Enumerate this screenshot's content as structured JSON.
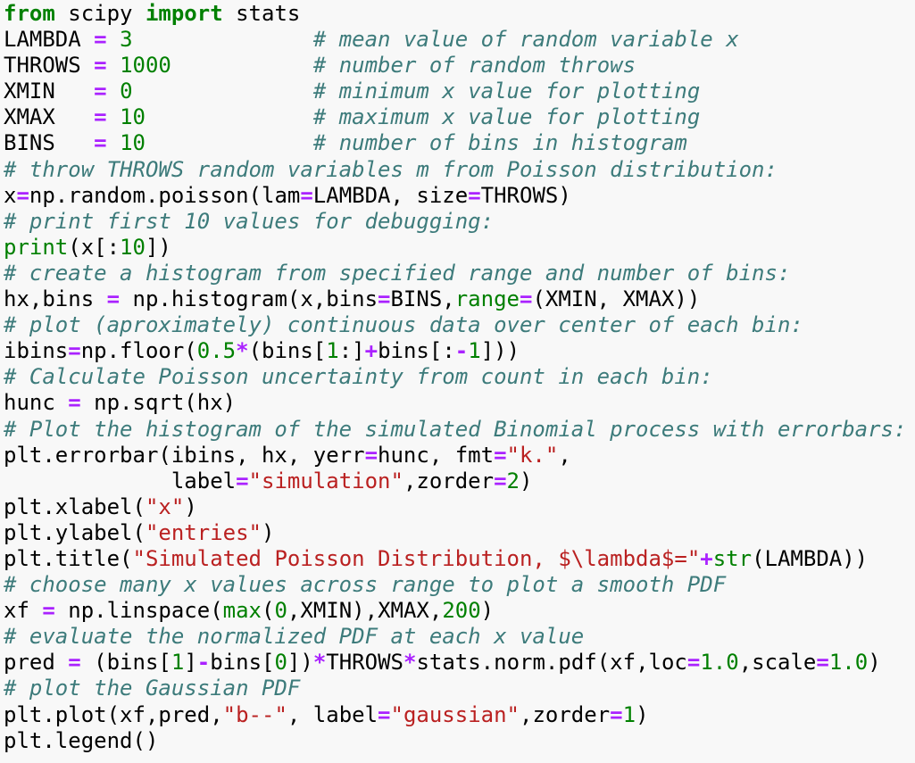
{
  "code_view": {
    "language": "python",
    "lines": [
      [
        {
          "t": "kw",
          "s": "from"
        },
        {
          "t": "pl",
          "s": " scipy "
        },
        {
          "t": "kw",
          "s": "import"
        },
        {
          "t": "pl",
          "s": " stats"
        }
      ],
      [
        {
          "t": "pl",
          "s": "LAMBDA "
        },
        {
          "t": "op",
          "s": "="
        },
        {
          "t": "pl",
          "s": " "
        },
        {
          "t": "num",
          "s": "3"
        },
        {
          "t": "pl",
          "s": "              "
        },
        {
          "t": "cm",
          "s": "# mean value of random variable x"
        }
      ],
      [
        {
          "t": "pl",
          "s": "THROWS "
        },
        {
          "t": "op",
          "s": "="
        },
        {
          "t": "pl",
          "s": " "
        },
        {
          "t": "num",
          "s": "1000"
        },
        {
          "t": "pl",
          "s": "           "
        },
        {
          "t": "cm",
          "s": "# number of random throws"
        }
      ],
      [
        {
          "t": "pl",
          "s": "XMIN   "
        },
        {
          "t": "op",
          "s": "="
        },
        {
          "t": "pl",
          "s": " "
        },
        {
          "t": "num",
          "s": "0"
        },
        {
          "t": "pl",
          "s": "              "
        },
        {
          "t": "cm",
          "s": "# minimum x value for plotting"
        }
      ],
      [
        {
          "t": "pl",
          "s": "XMAX   "
        },
        {
          "t": "op",
          "s": "="
        },
        {
          "t": "pl",
          "s": " "
        },
        {
          "t": "num",
          "s": "10"
        },
        {
          "t": "pl",
          "s": "             "
        },
        {
          "t": "cm",
          "s": "# maximum x value for plotting"
        }
      ],
      [
        {
          "t": "pl",
          "s": "BINS   "
        },
        {
          "t": "op",
          "s": "="
        },
        {
          "t": "pl",
          "s": " "
        },
        {
          "t": "num",
          "s": "10"
        },
        {
          "t": "pl",
          "s": "             "
        },
        {
          "t": "cm",
          "s": "# number of bins in histogram"
        }
      ],
      [
        {
          "t": "cm",
          "s": "# throw THROWS random variables m from Poisson distribution:"
        }
      ],
      [
        {
          "t": "pl",
          "s": "x"
        },
        {
          "t": "op",
          "s": "="
        },
        {
          "t": "pl",
          "s": "np.random.poisson(lam"
        },
        {
          "t": "op",
          "s": "="
        },
        {
          "t": "pl",
          "s": "LAMBDA, size"
        },
        {
          "t": "op",
          "s": "="
        },
        {
          "t": "pl",
          "s": "THROWS)"
        }
      ],
      [
        {
          "t": "cm",
          "s": "# print first 10 values for debugging:"
        }
      ],
      [
        {
          "t": "bi",
          "s": "print"
        },
        {
          "t": "pl",
          "s": "(x[:"
        },
        {
          "t": "num",
          "s": "10"
        },
        {
          "t": "pl",
          "s": "])"
        }
      ],
      [
        {
          "t": "cm",
          "s": "# create a histogram from specified range and number of bins:"
        }
      ],
      [
        {
          "t": "pl",
          "s": "hx,bins "
        },
        {
          "t": "op",
          "s": "="
        },
        {
          "t": "pl",
          "s": " np.histogram(x,bins"
        },
        {
          "t": "op",
          "s": "="
        },
        {
          "t": "pl",
          "s": "BINS,"
        },
        {
          "t": "bi",
          "s": "range"
        },
        {
          "t": "op",
          "s": "="
        },
        {
          "t": "pl",
          "s": "(XMIN, XMAX))"
        }
      ],
      [
        {
          "t": "cm",
          "s": "# plot (aproximately) continuous data over center of each bin:"
        }
      ],
      [
        {
          "t": "pl",
          "s": "ibins"
        },
        {
          "t": "op",
          "s": "="
        },
        {
          "t": "pl",
          "s": "np.floor("
        },
        {
          "t": "num",
          "s": "0.5"
        },
        {
          "t": "op",
          "s": "*"
        },
        {
          "t": "pl",
          "s": "(bins["
        },
        {
          "t": "num",
          "s": "1"
        },
        {
          "t": "pl",
          "s": ":]"
        },
        {
          "t": "op",
          "s": "+"
        },
        {
          "t": "pl",
          "s": "bins[:"
        },
        {
          "t": "op",
          "s": "-"
        },
        {
          "t": "num",
          "s": "1"
        },
        {
          "t": "pl",
          "s": "]))"
        }
      ],
      [
        {
          "t": "cm",
          "s": "# Calculate Poisson uncertainty from count in each bin:"
        }
      ],
      [
        {
          "t": "pl",
          "s": "hunc "
        },
        {
          "t": "op",
          "s": "="
        },
        {
          "t": "pl",
          "s": " np.sqrt(hx)"
        }
      ],
      [
        {
          "t": "cm",
          "s": "# Plot the histogram of the simulated Binomial process with errorbars:"
        }
      ],
      [
        {
          "t": "pl",
          "s": "plt.errorbar(ibins, hx, yerr"
        },
        {
          "t": "op",
          "s": "="
        },
        {
          "t": "pl",
          "s": "hunc, fmt"
        },
        {
          "t": "op",
          "s": "="
        },
        {
          "t": "str",
          "s": "\"k.\""
        },
        {
          "t": "pl",
          "s": ","
        }
      ],
      [
        {
          "t": "pl",
          "s": "             label"
        },
        {
          "t": "op",
          "s": "="
        },
        {
          "t": "str",
          "s": "\"simulation\""
        },
        {
          "t": "pl",
          "s": ",zorder"
        },
        {
          "t": "op",
          "s": "="
        },
        {
          "t": "num",
          "s": "2"
        },
        {
          "t": "pl",
          "s": ")"
        }
      ],
      [
        {
          "t": "pl",
          "s": "plt.xlabel("
        },
        {
          "t": "str",
          "s": "\"x\""
        },
        {
          "t": "pl",
          "s": ")"
        }
      ],
      [
        {
          "t": "pl",
          "s": "plt.ylabel("
        },
        {
          "t": "str",
          "s": "\"entries\""
        },
        {
          "t": "pl",
          "s": ")"
        }
      ],
      [
        {
          "t": "pl",
          "s": "plt.title("
        },
        {
          "t": "str",
          "s": "\"Simulated Poisson Distribution, $\\lambda$=\""
        },
        {
          "t": "op",
          "s": "+"
        },
        {
          "t": "bi",
          "s": "str"
        },
        {
          "t": "pl",
          "s": "(LAMBDA))"
        }
      ],
      [
        {
          "t": "cm",
          "s": "# choose many x values across range to plot a smooth PDF"
        }
      ],
      [
        {
          "t": "pl",
          "s": "xf "
        },
        {
          "t": "op",
          "s": "="
        },
        {
          "t": "pl",
          "s": " np.linspace("
        },
        {
          "t": "bi",
          "s": "max"
        },
        {
          "t": "pl",
          "s": "("
        },
        {
          "t": "num",
          "s": "0"
        },
        {
          "t": "pl",
          "s": ",XMIN),XMAX,"
        },
        {
          "t": "num",
          "s": "200"
        },
        {
          "t": "pl",
          "s": ")"
        }
      ],
      [
        {
          "t": "cm",
          "s": "# evaluate the normalized PDF at each x value"
        }
      ],
      [
        {
          "t": "pl",
          "s": "pred "
        },
        {
          "t": "op",
          "s": "="
        },
        {
          "t": "pl",
          "s": " (bins["
        },
        {
          "t": "num",
          "s": "1"
        },
        {
          "t": "pl",
          "s": "]"
        },
        {
          "t": "op",
          "s": "-"
        },
        {
          "t": "pl",
          "s": "bins["
        },
        {
          "t": "num",
          "s": "0"
        },
        {
          "t": "pl",
          "s": "])"
        },
        {
          "t": "op",
          "s": "*"
        },
        {
          "t": "pl",
          "s": "THROWS"
        },
        {
          "t": "op",
          "s": "*"
        },
        {
          "t": "pl",
          "s": "stats.norm.pdf(xf,loc"
        },
        {
          "t": "op",
          "s": "="
        },
        {
          "t": "num",
          "s": "1.0"
        },
        {
          "t": "pl",
          "s": ",scale"
        },
        {
          "t": "op",
          "s": "="
        },
        {
          "t": "num",
          "s": "1.0"
        },
        {
          "t": "pl",
          "s": ")"
        }
      ],
      [
        {
          "t": "cm",
          "s": "# plot the Gaussian PDF"
        }
      ],
      [
        {
          "t": "pl",
          "s": "plt.plot(xf,pred,"
        },
        {
          "t": "str",
          "s": "\"b--\""
        },
        {
          "t": "pl",
          "s": ", label"
        },
        {
          "t": "op",
          "s": "="
        },
        {
          "t": "str",
          "s": "\"gaussian\""
        },
        {
          "t": "pl",
          "s": ",zorder"
        },
        {
          "t": "op",
          "s": "="
        },
        {
          "t": "num",
          "s": "1"
        },
        {
          "t": "pl",
          "s": ")"
        }
      ],
      [
        {
          "t": "pl",
          "s": "plt.legend()"
        }
      ]
    ]
  }
}
